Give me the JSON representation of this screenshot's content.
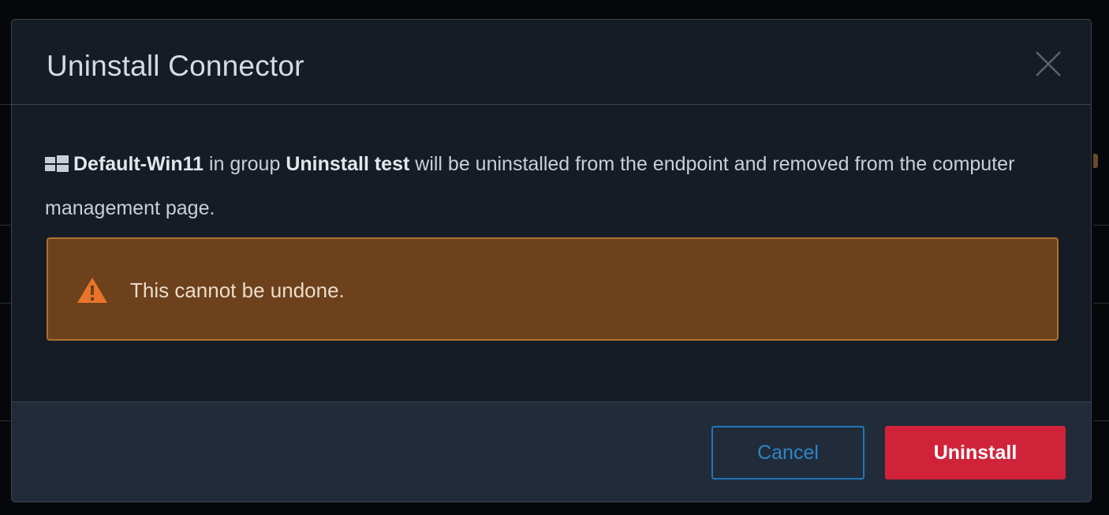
{
  "dialog": {
    "title": "Uninstall Connector",
    "close_label": "Close"
  },
  "message": {
    "os_icon": "windows-icon",
    "computer_name": "Default-Win11",
    "group_prefix": " in group ",
    "group_name": "Uninstall test",
    "suffix": " will be uninstalled from the endpoint and removed from the computer management page."
  },
  "warning": {
    "icon": "warning-triangle-icon",
    "text": "This cannot be undone."
  },
  "footer": {
    "cancel_label": "Cancel",
    "uninstall_label": "Uninstall"
  },
  "colors": {
    "modal_bg": "#161c25",
    "footer_bg": "#212b3a",
    "warning_bg": "#6c411c",
    "warning_border": "#b0702e",
    "warning_icon": "#e8742a",
    "cancel_border": "#1f77b6",
    "uninstall_bg": "#d0233a"
  }
}
